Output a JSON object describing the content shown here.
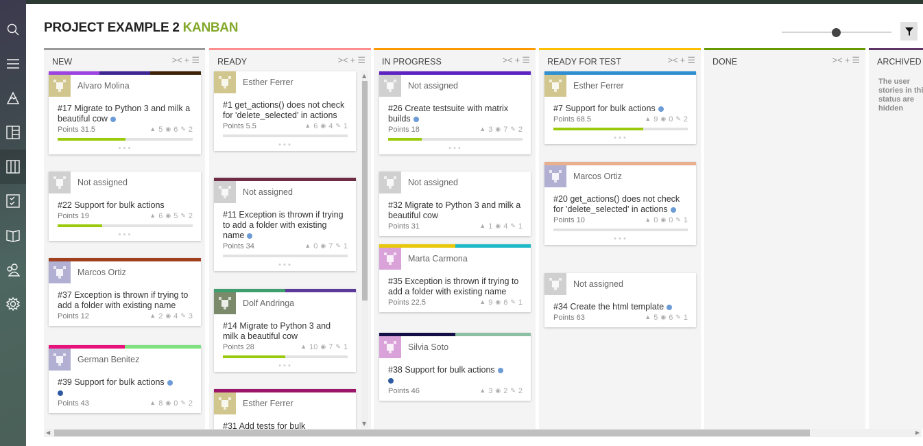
{
  "header": {
    "project": "PROJECT EXAMPLE 2",
    "section": "KANBAN"
  },
  "sidebar": {
    "items": [
      {
        "name": "search",
        "icon": "search-icon"
      },
      {
        "name": "menu",
        "icon": "hamburger-icon"
      },
      {
        "name": "timeline",
        "icon": "mountain-icon"
      },
      {
        "name": "backlog",
        "icon": "layout-icon"
      },
      {
        "name": "kanban",
        "icon": "columns-icon",
        "active": true
      },
      {
        "name": "issues",
        "icon": "checklist-icon"
      },
      {
        "name": "wiki",
        "icon": "book-icon"
      },
      {
        "name": "team",
        "icon": "users-icon"
      },
      {
        "name": "admin",
        "icon": "gear-icon"
      }
    ]
  },
  "toolbar": {
    "zoom_level": 0.5,
    "filter_icon": "filter-icon"
  },
  "columns": [
    {
      "name": "NEW",
      "color": "#999999"
    },
    {
      "name": "READY",
      "color": "#fc8e8e"
    },
    {
      "name": "IN PROGRESS",
      "color": "#ff9900"
    },
    {
      "name": "READY FOR TEST",
      "color": "#fcc000"
    },
    {
      "name": "DONE",
      "color": "#669900"
    },
    {
      "name": "ARCHIVED",
      "color": "#5c3566",
      "message": "The user stories in this status are hidden"
    }
  ],
  "column_actions": {
    "fold": "><",
    "add": "+",
    "bulk": "☰"
  },
  "cards": {
    "new": [
      {
        "assignee": "Alvaro Molina",
        "title": "#17 Migrate to Python 3 and milk a beautiful cow",
        "points": "Points 31.5",
        "votes": "5",
        "watchers": "6",
        "attachments": "2",
        "progress": 0.5,
        "tags": [
          "#9b44e0",
          "#402690",
          "#3d2206"
        ],
        "dots": [
          "#6c9bd5"
        ]
      },
      {
        "assignee": "Not assigned",
        "title": "#22 Support for bulk actions",
        "points": "Points 19",
        "votes": "6",
        "watchers": "5",
        "attachments": "2",
        "progress": 0.33,
        "tags": [],
        "dots": []
      },
      {
        "assignee": "Marcos Ortiz",
        "title": "#37 Exception is thrown if trying to add a folder with existing name",
        "points": "Points 12",
        "votes": "2",
        "watchers": "4",
        "attachments": "3",
        "tags": [
          "#a0401e"
        ],
        "dots": []
      },
      {
        "assignee": "German Benitez",
        "title": "#39 Support for bulk actions",
        "points": "Points 43",
        "votes": "8",
        "watchers": "0",
        "attachments": "2",
        "tags": [
          "#e8127c",
          "#7ee07e"
        ],
        "dots": [
          "#6c9bd5",
          "#2e5aa3"
        ]
      }
    ],
    "ready": [
      {
        "assignee": "Esther Ferrer",
        "title": "#1 get_actions() does not check for 'delete_selected' in actions",
        "points": "Points 5.5",
        "votes": "6",
        "watchers": "4",
        "attachments": "1",
        "progress": 0,
        "tags": [],
        "dots": []
      },
      {
        "assignee": "Not assigned",
        "title": "#11 Exception is thrown if trying to add a folder with existing name",
        "points": "Points 34",
        "votes": "0",
        "watchers": "7",
        "attachments": "1",
        "progress": 0,
        "tags": [
          "#6e2d44"
        ],
        "dots": [
          "#6c9bd5"
        ]
      },
      {
        "assignee": "Dolf Andringa",
        "title": "#14 Migrate to Python 3 and milk a beautiful cow",
        "points": "Points 28",
        "votes": "10",
        "watchers": "7",
        "attachments": "1",
        "progress": 0.5,
        "tags": [
          "#3f9e6e",
          "#5c3a9a"
        ],
        "dots": []
      },
      {
        "assignee": "Esther Ferrer",
        "title": "#31 Add tests for bulk",
        "tags": [
          "#9b1668"
        ],
        "dots": []
      }
    ],
    "in_progress": [
      {
        "assignee": "Not assigned",
        "title": "#26 Create testsuite with matrix builds",
        "points": "Points 18",
        "votes": "3",
        "watchers": "7",
        "attachments": "2",
        "progress": 0.25,
        "tags": [
          "#5e22c0"
        ],
        "dots": [
          "#6c9bd5"
        ]
      },
      {
        "assignee": "Not assigned",
        "title": "#32 Migrate to Python 3 and milk a beautiful cow",
        "points": "Points 31",
        "votes": "1",
        "watchers": "4",
        "attachments": "1",
        "tags": [],
        "dots": []
      },
      {
        "assignee": "Marta Carmona",
        "title": "#35 Exception is thrown if trying to add a folder with existing name",
        "points": "Points 22.5",
        "votes": "9",
        "watchers": "6",
        "attachments": "1",
        "tags": [
          "#e8c80c",
          "#1fbac8"
        ],
        "dots": []
      },
      {
        "assignee": "Silvia Soto",
        "title": "#38 Support for bulk actions",
        "points": "Points 46",
        "votes": "3",
        "watchers": "2",
        "attachments": "2",
        "tags": [
          "#150f48",
          "#8cc0a2"
        ],
        "dots": [
          "#6c9bd5",
          "#2e5aa3"
        ]
      }
    ],
    "ready_for_test": [
      {
        "assignee": "Esther Ferrer",
        "title": "#7 Support for bulk actions",
        "points": "Points 68.5",
        "votes": "9",
        "watchers": "0",
        "attachments": "2",
        "progress": 0.67,
        "tags": [
          "#2f8fd0"
        ],
        "dots": [
          "#6c9bd5"
        ]
      },
      {
        "assignee": "Marcos Ortiz",
        "title": "#20 get_actions() does not check for 'delete_selected' in actions",
        "points": "Points 10",
        "votes": "0",
        "watchers": "0",
        "attachments": "1",
        "progress": 0,
        "tags": [
          "#e8b08f"
        ],
        "dots": [
          "#6c9bd5"
        ]
      },
      {
        "assignee": "Not assigned",
        "title": "#34 Create the html template",
        "points": "Points 63",
        "votes": "5",
        "watchers": "6",
        "attachments": "1",
        "tags": [],
        "dots": [
          "#6c9bd5"
        ]
      }
    ]
  }
}
